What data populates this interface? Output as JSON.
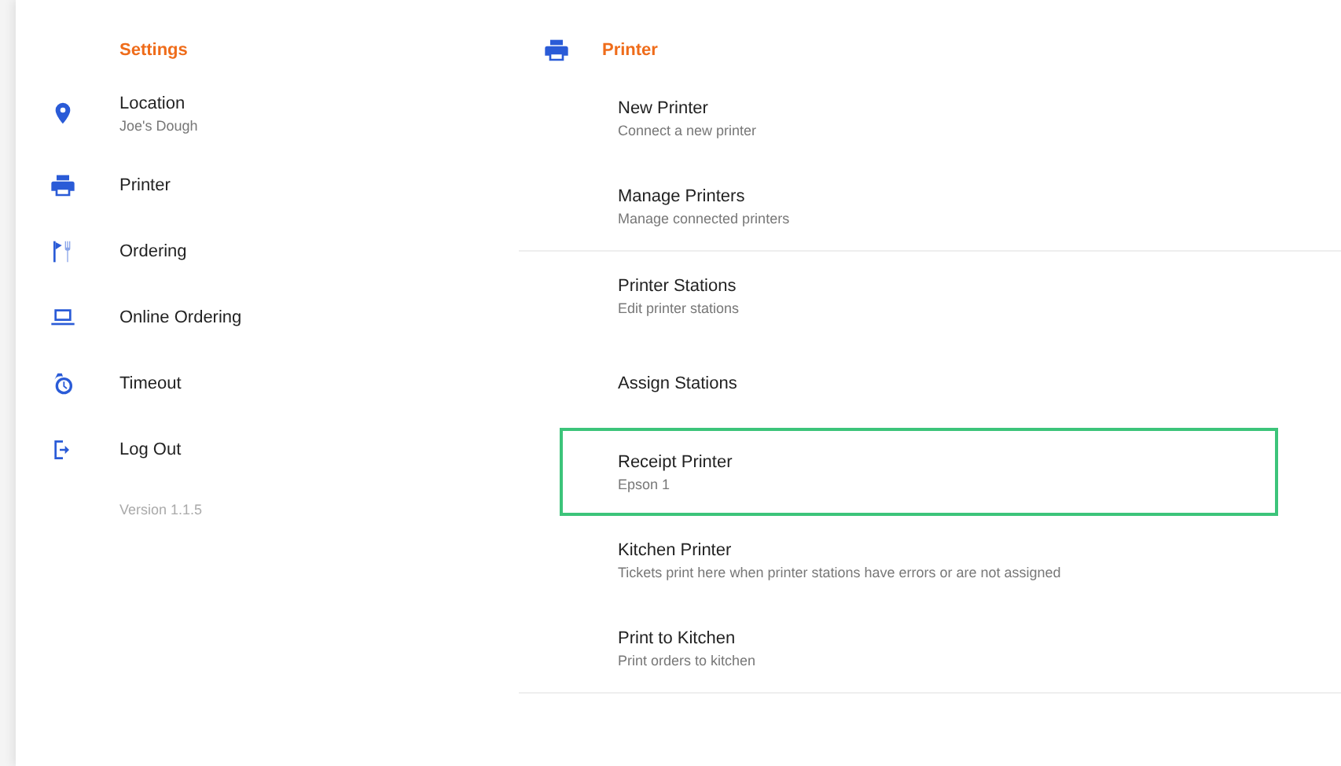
{
  "sidebar": {
    "title": "Settings",
    "items": [
      {
        "label": "Location",
        "detail": "Joe's Dough"
      },
      {
        "label": "Printer"
      },
      {
        "label": "Ordering"
      },
      {
        "label": "Online Ordering"
      },
      {
        "label": "Timeout"
      },
      {
        "label": "Log Out"
      }
    ],
    "version": "Version 1.1.5"
  },
  "printer": {
    "title": "Printer",
    "groups": [
      {
        "items": [
          {
            "label": "New Printer",
            "detail": "Connect a new printer",
            "highlighted": false
          },
          {
            "label": "Manage Printers",
            "detail": "Manage connected printers",
            "highlighted": false
          }
        ]
      },
      {
        "items": [
          {
            "label": "Printer Stations",
            "detail": "Edit printer stations",
            "highlighted": false
          },
          {
            "label": "Assign Stations",
            "highlighted": false
          },
          {
            "label": "Receipt Printer",
            "detail": "Epson 1",
            "highlighted": true
          },
          {
            "label": "Kitchen Printer",
            "detail": "Tickets print here when printer stations have errors or are not assigned",
            "highlighted": false
          },
          {
            "label": "Print to Kitchen",
            "detail": "Print orders to kitchen",
            "highlighted": false
          }
        ]
      }
    ]
  }
}
